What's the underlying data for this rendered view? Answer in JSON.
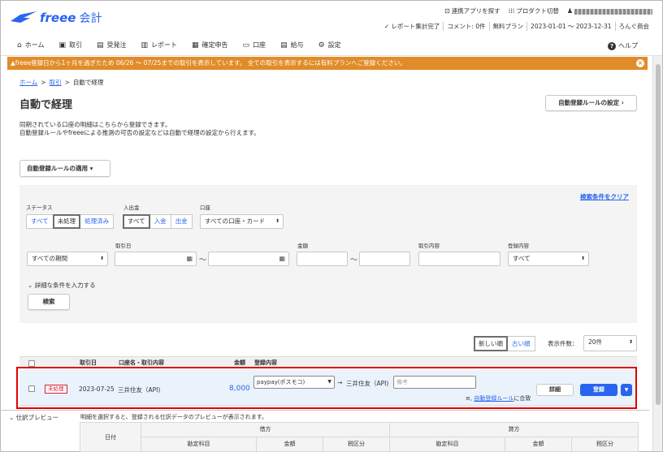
{
  "header": {
    "brand": "freee",
    "product": "会計",
    "utils": {
      "connect_app": "連携アプリを探す",
      "product_switch": "プロダクト切替"
    },
    "meta": {
      "report": "レポート集計完了",
      "comment": "コメント: 0件",
      "plan": "無料プラン",
      "period": "2023-01-01 ～ 2023-12-31",
      "company": "ろんぐ商会"
    }
  },
  "nav": {
    "items": [
      {
        "label": "ホーム",
        "icon": "home-icon"
      },
      {
        "label": "取引",
        "icon": "ledger-icon"
      },
      {
        "label": "受発注",
        "icon": "order-icon"
      },
      {
        "label": "レポート",
        "icon": "report-icon"
      },
      {
        "label": "確定申告",
        "icon": "tax-return-icon"
      },
      {
        "label": "口座",
        "icon": "account-card-icon"
      },
      {
        "label": "給与",
        "icon": "payroll-icon"
      },
      {
        "label": "設定",
        "icon": "gear-icon"
      }
    ],
    "help": "ヘルプ"
  },
  "banner": {
    "text": "freee登録日から1ヶ月を過ぎたため 06/26 ～ 07/25までの取引を表示しています。 全ての取引を表示するには有料プランへご登録ください。"
  },
  "breadcrumb": {
    "home": "ホーム",
    "deals": "取引",
    "current": "自動で経理"
  },
  "page": {
    "title": "自動で経理",
    "rule_settings_button": "自動登録ルールの設定",
    "desc_line1": "同期されている口座の明細はこちらから登録できます。",
    "desc_line2": "自動登録ルールやfreeeによる推測の可否の設定などは自動で経理の設定から行えます。",
    "apply_rules_button": "自動登録ルールの適用"
  },
  "filter": {
    "clear": "検索条件をクリア",
    "status_label": "ステータス",
    "status_options": [
      "すべて",
      "未処理",
      "処理済み"
    ],
    "status_selected": "未処理",
    "inout_label": "入出金",
    "inout_options": [
      "すべて",
      "入金",
      "出金"
    ],
    "inout_selected": "すべて",
    "account_label": "口座",
    "account_value": "すべての口座・カード",
    "period_value": "すべての期間",
    "date_label": "取引日",
    "amount_label": "金額",
    "content_label": "取引内容",
    "reg_label": "登録内容",
    "reg_value": "すべて",
    "tilde": "～",
    "more": "詳細な条件を入力する",
    "search": "検索"
  },
  "list": {
    "sort_new": "新しい順",
    "sort_old": "古い順",
    "count_label": "表示件数：",
    "count_value": "20件",
    "headers": {
      "date": "取引日",
      "account": "口座名・取引内容",
      "amount": "金額",
      "registration": "登録内容"
    },
    "rows": [
      {
        "status": "未処理",
        "date": "2023-07-25",
        "desc": "三井住友（API)",
        "amount": "8,000",
        "account_item": "paypay(ポスモコ)",
        "partner": "三井住友（API)",
        "memo_placeholder": "備考",
        "detail": "詳細",
        "register": "登録",
        "rule_link": "自動登録ルール",
        "rule_suffix": "に合致"
      }
    ]
  },
  "preview": {
    "title": "仕訳プレビュー",
    "message": "明細を選択すると、登録される仕訳データのプレビューが表示されます。",
    "date": "日付",
    "debit": "借方",
    "credit": "貸方",
    "account": "勘定科目",
    "amount": "金額",
    "tax": "税区分"
  },
  "colors": {
    "brand": "#2864f0",
    "banner": "#e18c28",
    "status_red": "#dc1e32",
    "highlight": "#e00000"
  }
}
